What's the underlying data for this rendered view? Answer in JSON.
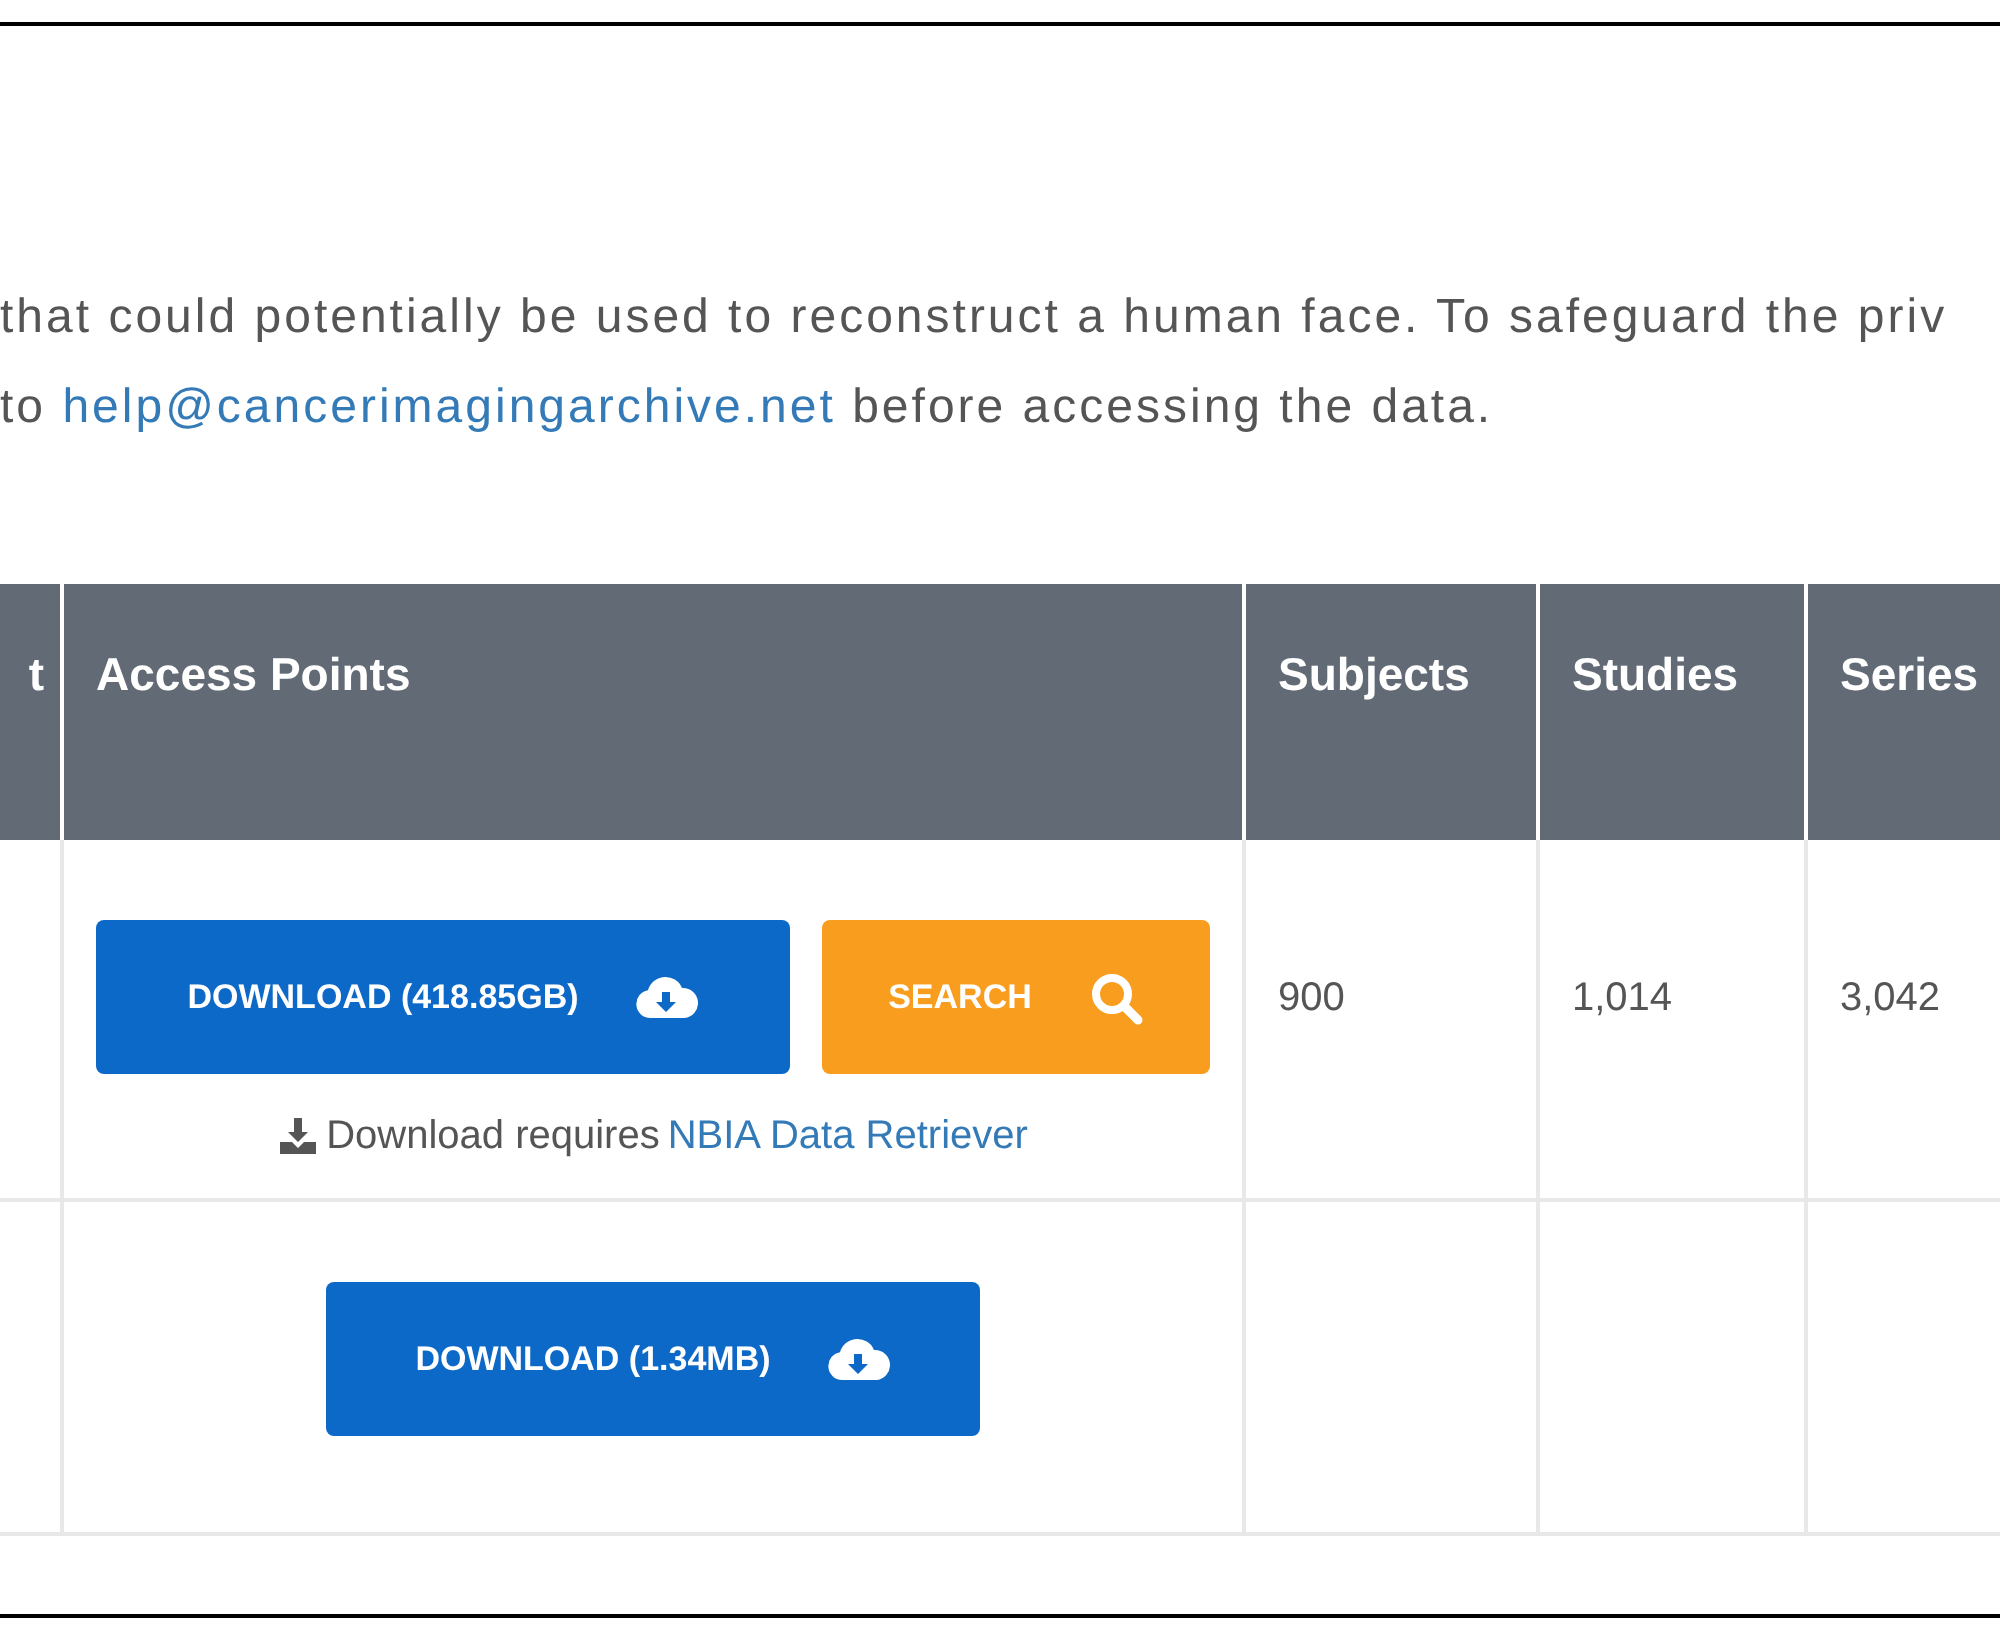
{
  "notice": {
    "line_1": "that could potentially be used to reconstruct a human face. To safeguard the priv",
    "line_2_before": "to ",
    "line_2_link": "help@cancerimagingarchive.net",
    "line_2_after": " before accessing the data."
  },
  "table": {
    "columns": [
      "t",
      "Access Points",
      "Subjects",
      "Studies",
      "Series"
    ],
    "rows": [
      {
        "buttons": [
          {
            "kind": "download",
            "label": "DOWNLOAD (418.85GB)"
          },
          {
            "kind": "search",
            "label": "SEARCH"
          }
        ],
        "note": {
          "text": "Download requires ",
          "link": "NBIA Data Retriever"
        },
        "subjects": "900",
        "studies": "1,014",
        "series": "3,042"
      },
      {
        "buttons": [
          {
            "kind": "download",
            "label": "DOWNLOAD (1.34MB)"
          }
        ]
      }
    ]
  }
}
